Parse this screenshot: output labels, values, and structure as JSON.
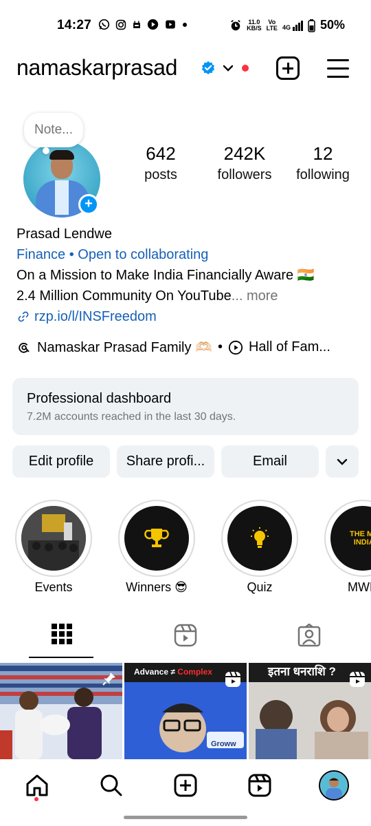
{
  "status_bar": {
    "time": "14:27",
    "net_speed_top": "11.0",
    "net_speed_bottom": "KB/S",
    "volte_top": "Vo",
    "volte_bottom": "LTE",
    "network": "4G",
    "battery": "50%"
  },
  "header": {
    "username": "namaskarprasad"
  },
  "profile": {
    "note_placeholder": "Note...",
    "stats": [
      {
        "value": "642",
        "label": "posts"
      },
      {
        "value": "242K",
        "label": "followers"
      },
      {
        "value": "12",
        "label": "following"
      }
    ],
    "name": "Prasad Lendwe",
    "category": "Finance",
    "separator": " • ",
    "collab": "Open to collaborating",
    "bio_line1": "On a Mission to Make India Financially Aware 🇮🇳",
    "bio_line2": "2.4 Million Community On YouTube",
    "more_label": "... more",
    "link": "rzp.io/l/INSFreedom",
    "threads_label": "Namaskar Prasad Family 🫶🏻",
    "dot": "•",
    "hall_label": "Hall of Fam..."
  },
  "dashboard": {
    "title": "Professional dashboard",
    "subtitle": "7.2M accounts reached in the last 30 days."
  },
  "buttons": {
    "edit": "Edit profile",
    "share": "Share profi...",
    "email": "Email"
  },
  "highlights": [
    {
      "label": "Events",
      "icon": "event-photo"
    },
    {
      "label": "Winners 😎",
      "icon": "trophy-icon"
    },
    {
      "label": "Quiz",
      "icon": "lightbulb-icon"
    },
    {
      "label": "MWE",
      "icon": "mwe-cover"
    }
  ],
  "highlight_mwe_text": "THE ME\nINDIA",
  "grid": [
    {
      "caption": "",
      "type": "photo"
    },
    {
      "caption_a": "Advance ≠ ",
      "caption_b": "Complex",
      "badge": "Groww",
      "type": "reel"
    },
    {
      "caption": "इतना धनराशि ?",
      "type": "reel"
    }
  ],
  "colors": {
    "accent": "#0095f6",
    "link": "#1560b8",
    "muted": "#737373",
    "surface": "#eff2f5",
    "notification": "#ff3040"
  }
}
